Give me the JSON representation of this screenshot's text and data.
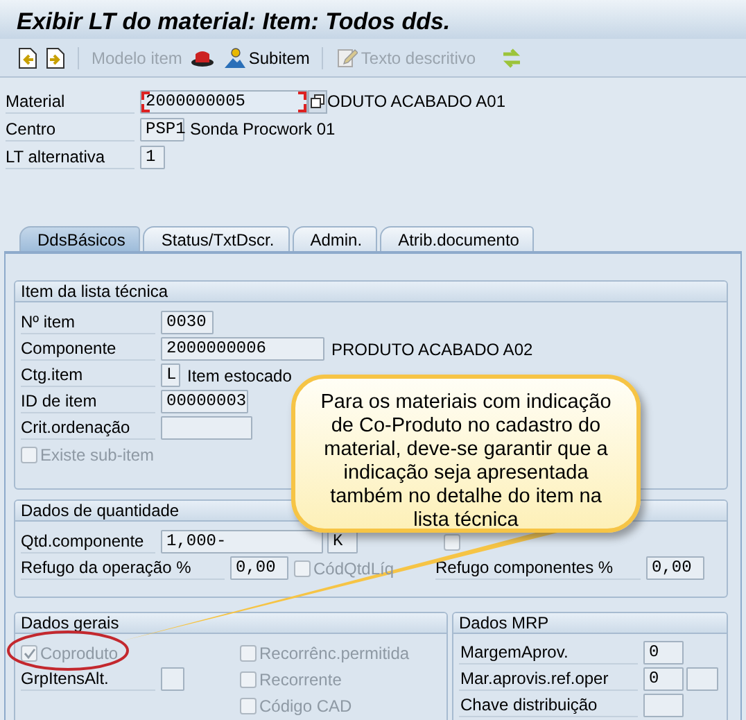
{
  "window": {
    "title": "Exibir LT do material: Item: Todos dds."
  },
  "toolbar": {
    "buttons": [
      {
        "label": "Modelo item",
        "disabled": true
      },
      {
        "label": "Subitem",
        "disabled": false
      },
      {
        "label": "Texto descritivo",
        "disabled": true
      }
    ]
  },
  "header": [
    {
      "label": "Material",
      "value": "2000000005",
      "description": "ODUTO ACABADO A01",
      "focused": true
    },
    {
      "label": "Centro",
      "value": "PSP1",
      "description": "Sonda Procwork 01",
      "focused": false
    },
    {
      "label": "LT alternativa",
      "value": "1",
      "focused": false
    }
  ],
  "tabs": [
    {
      "label": "DdsBásicos",
      "selected": true
    },
    {
      "label": "Status/TxtDscr.",
      "selected": false
    },
    {
      "label": "Admin.",
      "selected": false
    },
    {
      "label": "Atrib.documento",
      "selected": false
    }
  ],
  "item_group": {
    "title": "Item da lista técnica",
    "rows": [
      {
        "kind": "field",
        "label": "Nº item",
        "value": "0030"
      },
      {
        "kind": "field",
        "label": "Componente",
        "value": "2000000006",
        "description": "PRODUTO ACABADO A02"
      },
      {
        "kind": "field",
        "label": "Ctg.item",
        "value": "L",
        "description": "Item estocado"
      },
      {
        "kind": "field",
        "label": "ID de item",
        "value": "00000003"
      },
      {
        "kind": "field",
        "label": "Crit.ordenação"
      },
      {
        "kind": "checkbox",
        "label": "Existe sub-item",
        "checked": false,
        "disabled": true
      }
    ]
  },
  "quantity_group": {
    "title": "Dados de quantidade",
    "component_qty": {
      "label": "Qtd.componente",
      "value": "1,000-",
      "unit": "K"
    },
    "fixed_qty": {
      "checked": false,
      "disabled": true
    },
    "scrap_operation": {
      "label": "Refugo da operação %",
      "value": "0,00"
    },
    "net_qty": {
      "label": "CódQtdLíq",
      "checked": false,
      "disabled": true
    },
    "scrap_component": {
      "label": "Refugo componentes %",
      "value": "0,00"
    }
  },
  "general_group": {
    "title": "Dados gerais",
    "checkboxes": [
      {
        "label": "Coproduto",
        "checked": true,
        "disabled": true
      },
      {
        "label": "Recorrênc.permitida",
        "checked": false,
        "disabled": true
      },
      {
        "label": "Recorrente",
        "checked": false,
        "disabled": true
      },
      {
        "label": "Código CAD",
        "checked": false,
        "disabled": true
      }
    ],
    "alt_group": {
      "label": "GrpItensAlt."
    }
  },
  "mrp_group": {
    "title": "Dados MRP",
    "rows": [
      {
        "label": "MargemAprov.",
        "value": "0",
        "extra_field": false
      },
      {
        "label": "Mar.aprovis.ref.oper",
        "value": "0",
        "extra_field": true
      },
      {
        "label": "Chave distribuição",
        "extra_field": false
      }
    ]
  },
  "callout": {
    "text": "Para os materiais com indicação de Co-Produto no cadastro do material, deve-se garantir que a indicação seja apresentada também no detalhe do item na lista técnica"
  }
}
